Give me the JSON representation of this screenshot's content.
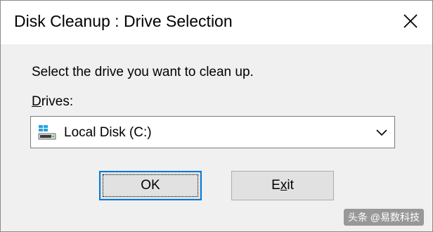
{
  "window": {
    "title": "Disk Cleanup : Drive Selection"
  },
  "dialog": {
    "prompt": "Select the drive you want to clean up.",
    "drives_label_accel": "D",
    "drives_label_rest": "rives:",
    "selected_drive": "Local Disk (C:)",
    "drive_icon": "hard-drive-icon"
  },
  "buttons": {
    "ok_label": "OK",
    "exit_accel": "x",
    "exit_pre": "E",
    "exit_post": "it"
  },
  "watermark": {
    "text": "头条 @易数科技"
  },
  "colors": {
    "accent": "#0078d7",
    "drive_icon_blue": "#2aa3e0"
  }
}
